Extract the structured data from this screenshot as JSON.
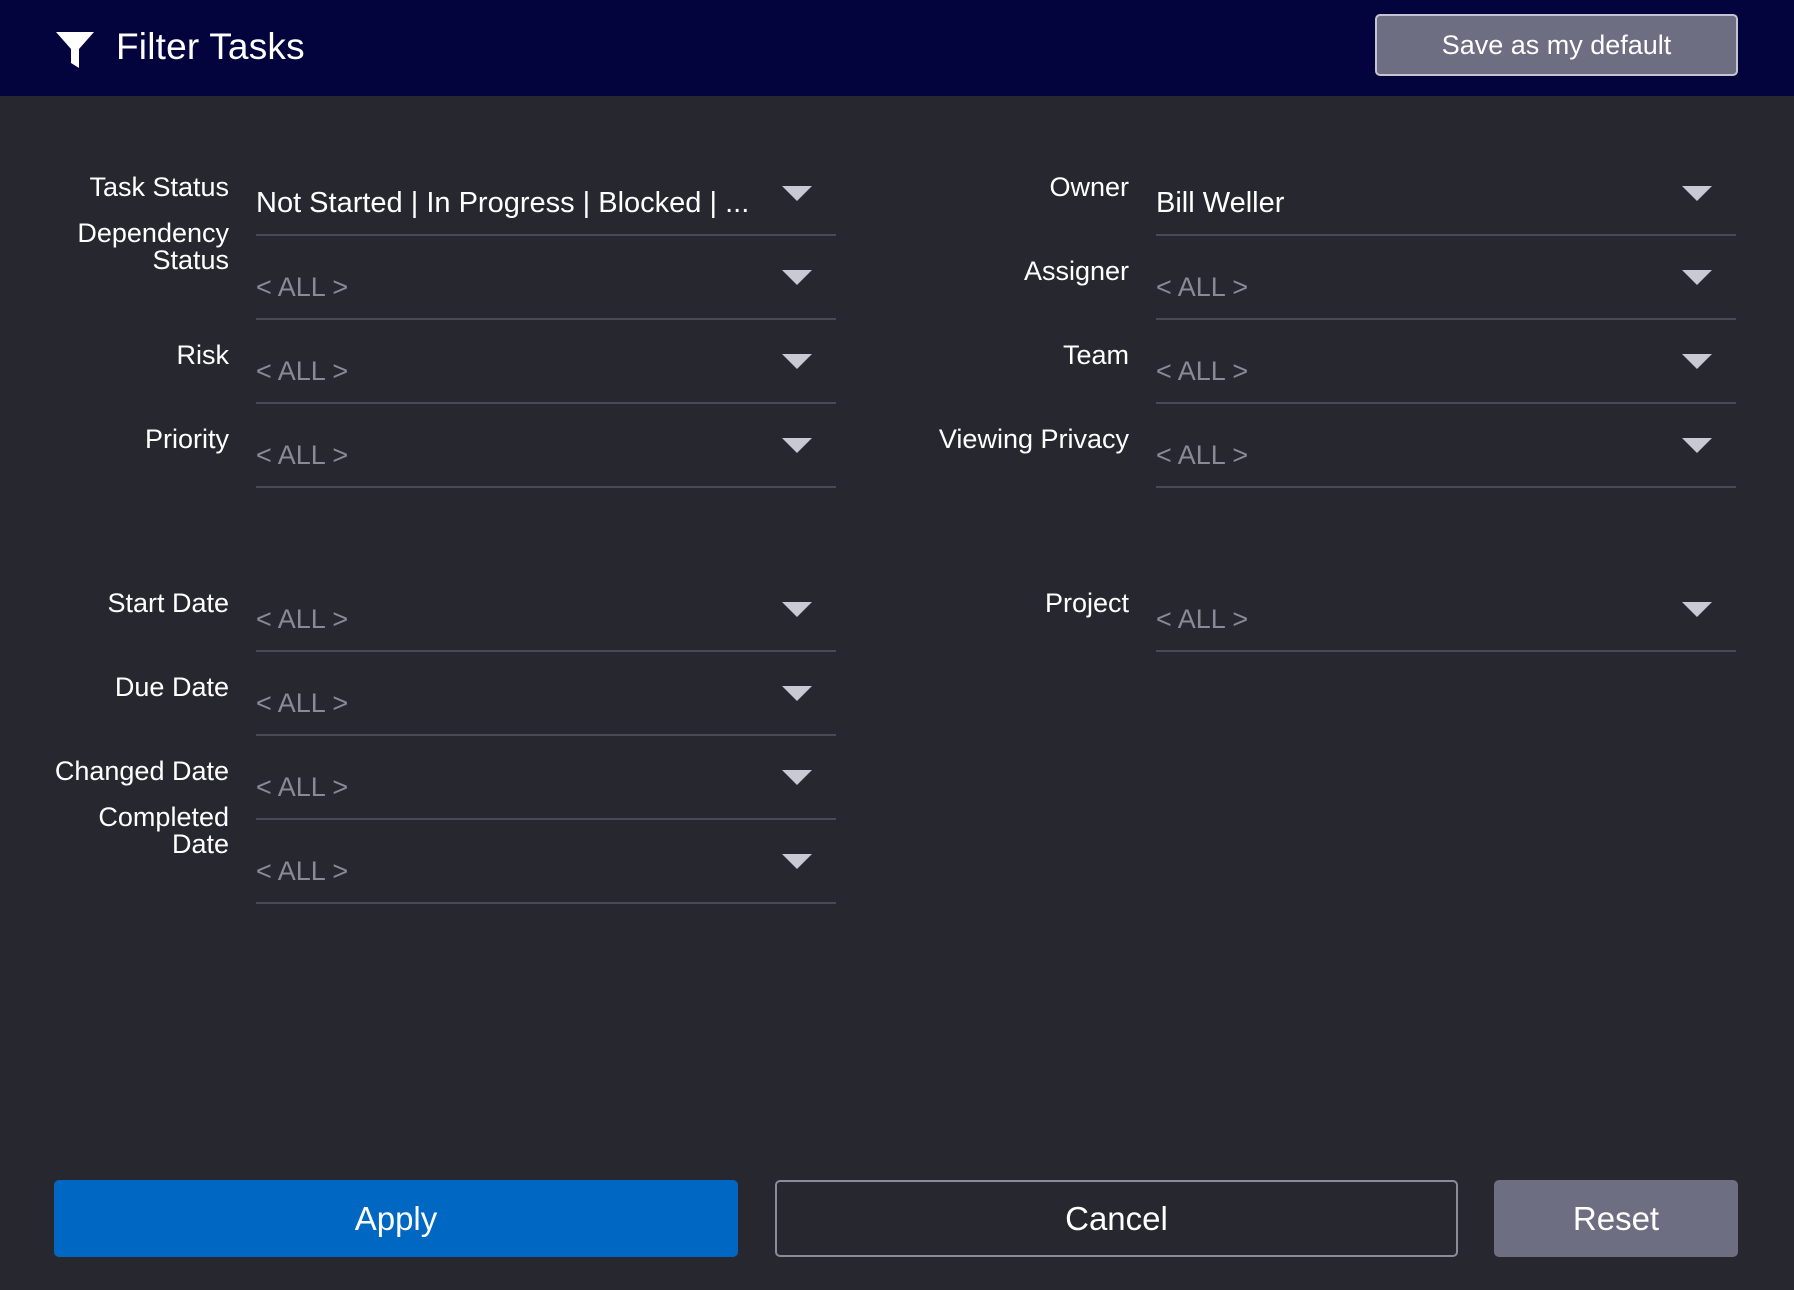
{
  "header": {
    "title": "Filter Tasks",
    "save_default_label": "Save as my default",
    "icon": "filter-funnel-icon",
    "background_color": "#03033d"
  },
  "left_fields": [
    {
      "id": "task-status",
      "label_lines": [
        "Task Status"
      ],
      "value": "Not Started  |  In Progress  |  Blocked  | ...",
      "is_placeholder": false
    },
    {
      "id": "dependency-status",
      "label_lines": [
        "Dependency",
        "Status"
      ],
      "value": "< ALL >",
      "is_placeholder": true
    },
    {
      "id": "risk",
      "label_lines": [
        "Risk"
      ],
      "value": "< ALL >",
      "is_placeholder": true
    },
    {
      "id": "priority",
      "label_lines": [
        "Priority"
      ],
      "value": "< ALL >",
      "is_placeholder": true
    },
    {
      "id": "start-date",
      "label_lines": [
        "Start Date"
      ],
      "value": "< ALL >",
      "is_placeholder": true
    },
    {
      "id": "due-date",
      "label_lines": [
        "Due Date"
      ],
      "value": "< ALL >",
      "is_placeholder": true
    },
    {
      "id": "changed-date",
      "label_lines": [
        "Changed Date"
      ],
      "value": "< ALL >",
      "is_placeholder": true
    },
    {
      "id": "completed-date",
      "label_lines": [
        "Completed",
        "Date"
      ],
      "value": "< ALL >",
      "is_placeholder": true
    }
  ],
  "right_fields": [
    {
      "id": "owner",
      "label_lines": [
        "Owner"
      ],
      "value": "Bill Weller",
      "is_placeholder": false
    },
    {
      "id": "assigner",
      "label_lines": [
        "Assigner"
      ],
      "value": "< ALL >",
      "is_placeholder": true
    },
    {
      "id": "team",
      "label_lines": [
        "Team"
      ],
      "value": "< ALL >",
      "is_placeholder": true
    },
    {
      "id": "viewing-privacy",
      "label_lines": [
        "Viewing Privacy"
      ],
      "value": "< ALL >",
      "is_placeholder": true
    },
    {
      "id": "project",
      "label_lines": [
        "Project"
      ],
      "value": "< ALL >",
      "is_placeholder": true
    }
  ],
  "footer": {
    "apply_label": "Apply",
    "cancel_label": "Cancel",
    "reset_label": "Reset"
  },
  "colors": {
    "background": "#27272f",
    "apply": "#0068c3",
    "reset": "#6e6e82",
    "placeholder_text": "#8a8a96"
  }
}
